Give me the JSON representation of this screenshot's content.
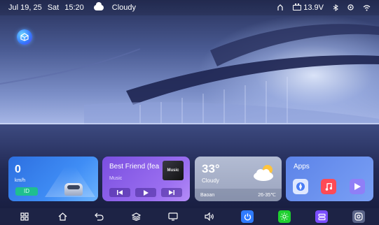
{
  "status_bar": {
    "date": "Jul 19, 25",
    "weekday": "Sat",
    "time": "15:20",
    "weather": "Cloudy",
    "battery_voltage": "13.9V",
    "icons": [
      "user-icon",
      "battery-icon",
      "bluetooth-icon",
      "location-icon",
      "wifi-icon"
    ]
  },
  "speed_card": {
    "value": "0",
    "unit": "km/h",
    "badge": "ID"
  },
  "music_card": {
    "title": "Best Friend (fea",
    "subtitle": "Music",
    "album_text": "Music",
    "controls": [
      "prev-icon",
      "play-icon",
      "next-icon"
    ]
  },
  "weather_card": {
    "temperature": "33°",
    "condition": "Cloudy",
    "location": "Baoan",
    "range": "26-35℃"
  },
  "apps_card": {
    "title": "Apps",
    "apps": [
      "navigation-app-icon",
      "music-app-icon",
      "video-app-icon"
    ]
  },
  "dock": {
    "items": [
      "grid-icon",
      "home-icon",
      "back-icon",
      "layers-icon",
      "screen-icon",
      "volume-icon",
      "power-icon",
      "brightness-icon",
      "settings-panel-icon",
      "camera-icon"
    ],
    "colors": {
      "power": "#2f7bff",
      "brightness": "#1fd02f",
      "settings": "#7a4dff",
      "camera": "#5a6488"
    }
  }
}
